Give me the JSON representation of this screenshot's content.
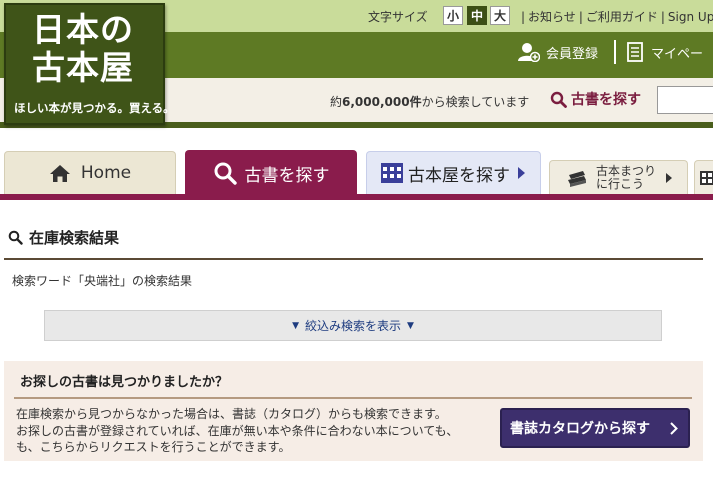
{
  "logo": {
    "line1": "日本の",
    "line2": "古本屋",
    "tagline": "ほしい本が見つかる。買える。"
  },
  "header": {
    "font_size_label": "文字サイズ",
    "font_sizes": {
      "small": "小",
      "medium": "中",
      "large": "大",
      "selected": "中"
    },
    "links": [
      "お知らせ",
      "ご利用ガイド",
      "Sign Up"
    ],
    "member_register": "会員登録",
    "mypage": "マイペー",
    "stock_prefix": "約",
    "stock_count": "6,000,000件",
    "stock_suffix": "から検索しています",
    "search_label": "古書を探す",
    "search_value": ""
  },
  "nav": {
    "home": "Home",
    "books": "古書を探す",
    "stores": "古本屋を探す",
    "festival_line1": "古本まつり",
    "festival_line2": "に行こう",
    "active": "古書を探す"
  },
  "results": {
    "heading": "在庫検索結果",
    "subtitle": "検索ワード「央端社」の検索結果",
    "refine_toggle": "絞込み検索を表示"
  },
  "not_found": {
    "title": "お探しの古書は見つかりましたか？",
    "lines": [
      "在庫検索から見つからなかった場合は、書誌（カタログ）からも検索できます。",
      "お探しの古書が登録されていれば、在庫が無い本や条件に合わない本についても、",
      "も、こちらからリクエストを行うことができます。"
    ],
    "button": "書誌カタログから探す"
  },
  "colors": {
    "header_green": "#5e7a24",
    "top_strip": "#c9dc9a",
    "accent_maroon": "#8a1c4c",
    "catalog_button": "#3d2f6d",
    "link_blue": "#1e3c80"
  }
}
